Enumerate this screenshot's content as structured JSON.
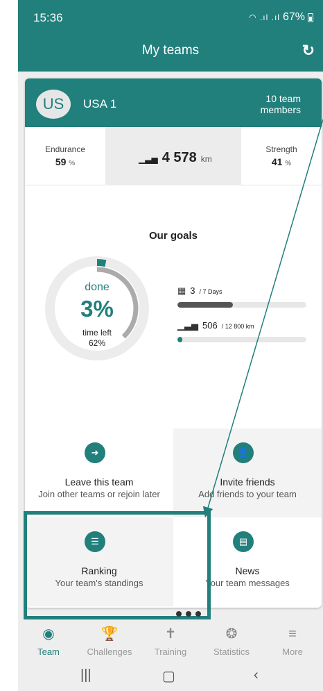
{
  "status_bar": {
    "time": "15:36",
    "battery": "67%"
  },
  "header": {
    "title": "My teams"
  },
  "team": {
    "initials": "US",
    "name": "USA 1",
    "members_line1": "10 team",
    "members_line2": "members"
  },
  "stats": {
    "endurance_label": "Endurance",
    "endurance_value": "59",
    "endurance_unit": "%",
    "distance_value": "4 578",
    "distance_unit": "km",
    "strength_label": "Strength",
    "strength_value": "41",
    "strength_unit": "%"
  },
  "goals": {
    "title": "Our goals",
    "done_label": "done",
    "done_percent": "3%",
    "time_left_label": "time left",
    "time_left_value": "62%",
    "days_value": "3",
    "days_total": "/ 7 Days",
    "days_fraction": 0.43,
    "km_value": "506",
    "km_total": "/ 12 800 km",
    "km_fraction": 0.04,
    "ring_done_fraction": 0.03,
    "ring_elapsed_fraction": 0.38
  },
  "actions": {
    "leave": {
      "title": "Leave this team",
      "subtitle": "Join other teams or rejoin later"
    },
    "invite": {
      "title": "Invite friends",
      "subtitle": "Add friends to your team"
    },
    "ranking": {
      "title": "Ranking",
      "subtitle": "Your team's standings"
    },
    "news": {
      "title": "News",
      "subtitle": "Your team messages"
    }
  },
  "bottom_nav": [
    {
      "label": "Team",
      "icon": "team-icon",
      "active": true
    },
    {
      "label": "Challenges",
      "icon": "trophy-icon",
      "active": false
    },
    {
      "label": "Training",
      "icon": "training-icon",
      "active": false
    },
    {
      "label": "Statistics",
      "icon": "award-icon",
      "active": false
    },
    {
      "label": "More",
      "icon": "menu-icon",
      "active": false
    }
  ],
  "colors": {
    "teal": "#217f7c",
    "dark_bar": "#555555"
  }
}
